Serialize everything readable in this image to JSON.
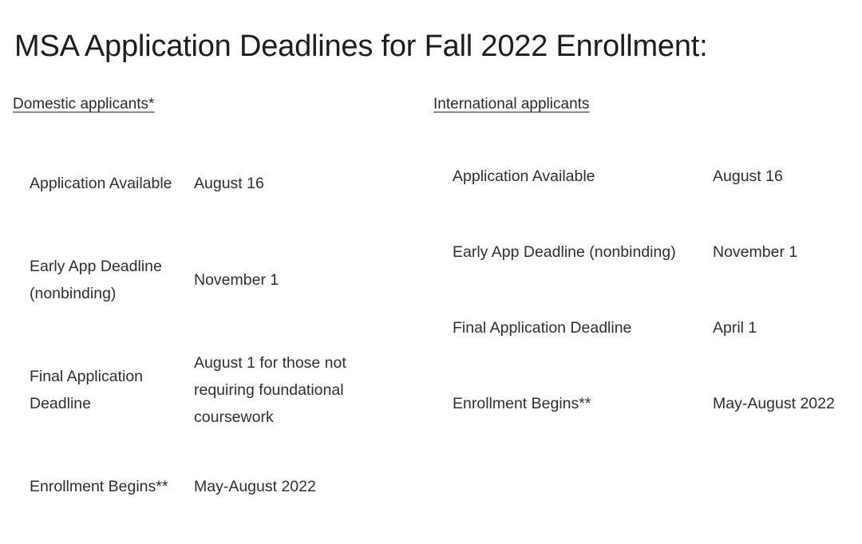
{
  "title": "MSA Application Deadlines for Fall 2022 Enrollment:",
  "columns": [
    {
      "id": "domestic",
      "heading": "Domestic applicants*",
      "rows": [
        {
          "label": "Application Available",
          "value": "August 16"
        },
        {
          "label": "Early App Deadline (nonbinding)",
          "value": "November 1"
        },
        {
          "label": "Final Application Deadline",
          "value": "August 1 for those not requiring foundational coursework"
        },
        {
          "label": "Enrollment Begins**",
          "value": "May-August 2022"
        }
      ]
    },
    {
      "id": "international",
      "heading": "International applicants",
      "rows": [
        {
          "label": "Application Available",
          "value": "August 16"
        },
        {
          "label": "Early App Deadline (nonbinding)",
          "value": "November 1"
        },
        {
          "label": "Final Application Deadline",
          "value": "April 1"
        },
        {
          "label": "Enrollment Begins**",
          "value": "May-August 2022"
        }
      ]
    }
  ]
}
